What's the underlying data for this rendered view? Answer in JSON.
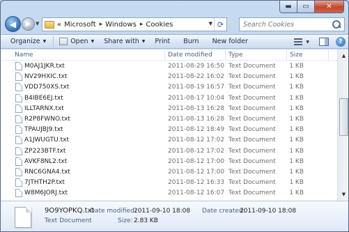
{
  "address": {
    "overflow": "«",
    "parts": [
      "Microsoft",
      "Windows",
      "Cookies"
    ]
  },
  "search": {
    "placeholder": "Search Cookies"
  },
  "toolbar": {
    "organize": "Organize",
    "open": "Open",
    "share_with": "Share with",
    "print": "Print",
    "burn": "Burn",
    "new_folder": "New folder"
  },
  "columns": {
    "name": "Name",
    "date_modified": "Date modified",
    "type": "Type",
    "size": "Size"
  },
  "files": [
    {
      "name": "M0AJ1JKR.txt",
      "date": "2011-08-29 16:50",
      "type": "Text Document",
      "size": "1 KB"
    },
    {
      "name": "NV29HXIC.txt",
      "date": "2011-08-22 16:02",
      "type": "Text Document",
      "size": "1 KB"
    },
    {
      "name": "VDD750XS.txt",
      "date": "2011-08-19 16:57",
      "type": "Text Document",
      "size": "1 KB"
    },
    {
      "name": "B4IBE6EJ.txt",
      "date": "2011-08-17 10:04",
      "type": "Text Document",
      "size": "1 KB"
    },
    {
      "name": "ILLTARNX.txt",
      "date": "2011-08-13 16:28",
      "type": "Text Document",
      "size": "1 KB"
    },
    {
      "name": "R2P8FWNO.txt",
      "date": "2011-08-13 16:28",
      "type": "Text Document",
      "size": "1 KB"
    },
    {
      "name": "TPAUJBJ9.txt",
      "date": "2011-08-12 18:49",
      "type": "Text Document",
      "size": "1 KB"
    },
    {
      "name": "A1JWUGTU.txt",
      "date": "2011-08-12 17:02",
      "type": "Text Document",
      "size": "1 KB"
    },
    {
      "name": "ZP223BTF.txt",
      "date": "2011-08-12 17:02",
      "type": "Text Document",
      "size": "1 KB"
    },
    {
      "name": "AVKF8NL2.txt",
      "date": "2011-08-12 17:00",
      "type": "Text Document",
      "size": "1 KB"
    },
    {
      "name": "RNC6GNA4.txt",
      "date": "2011-08-12 17:00",
      "type": "Text Document",
      "size": "1 KB"
    },
    {
      "name": "7JTHTH2P.txt",
      "date": "2011-08-12 16:33",
      "type": "Text Document",
      "size": "1 KB"
    },
    {
      "name": "W8M6JORJ.txt",
      "date": "2011-08-12 16:07",
      "type": "Text Document",
      "size": "1 KB"
    }
  ],
  "details": {
    "name": "9O9YOPKQ.txt",
    "type": "Text Document",
    "date_modified_label": "Date modified:",
    "date_modified": "2011-09-10 18:08",
    "size_label": "Size:",
    "size": "2.83 KB",
    "date_created_label": "Date created:",
    "date_created": "2011-09-10 18:08"
  },
  "colors": {
    "accent": "#2c6fb8",
    "close_button": "#c4452c"
  },
  "icons": [
    "back-icon",
    "forward-icon",
    "folder-icon",
    "refresh-icon",
    "search-icon",
    "view-icon",
    "preview-pane-icon",
    "help-icon",
    "text-file-icon"
  ]
}
